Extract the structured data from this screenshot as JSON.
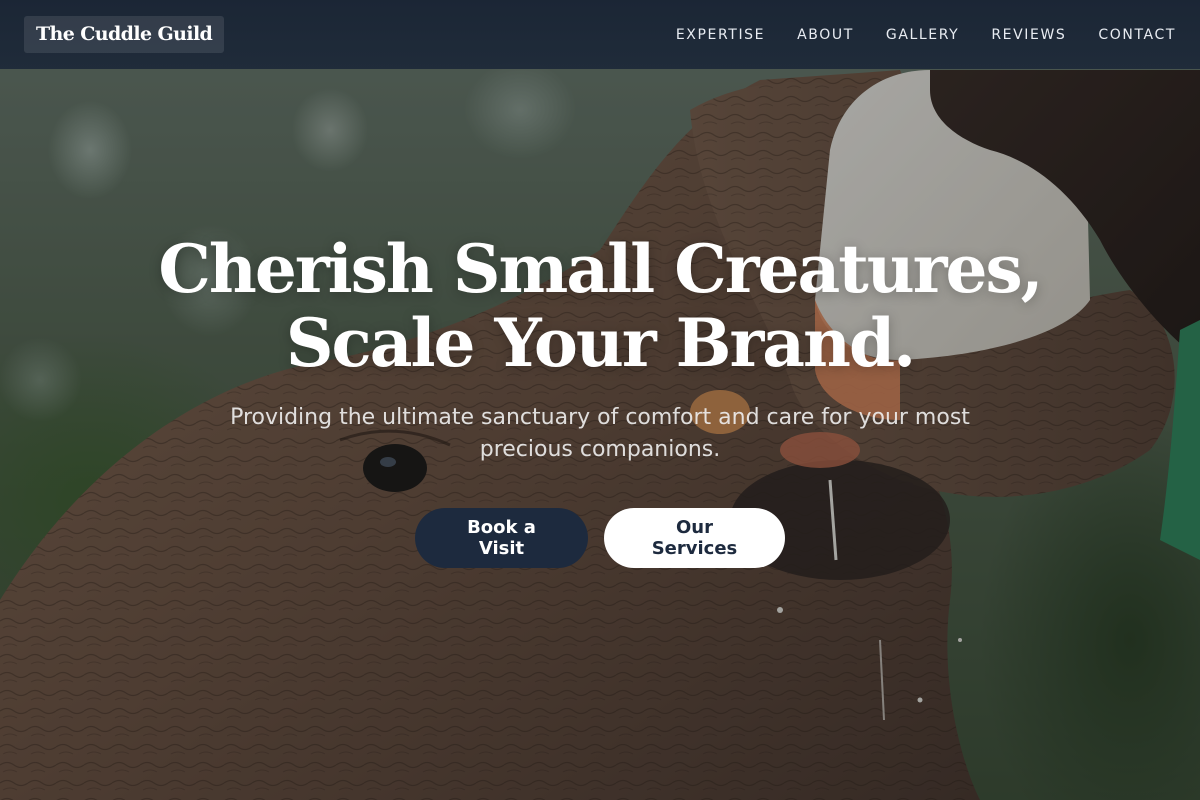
{
  "header": {
    "logo_text": "The Cuddle Guild",
    "nav": [
      {
        "label": "EXPERTISE"
      },
      {
        "label": "ABOUT"
      },
      {
        "label": "GALLERY"
      },
      {
        "label": "REVIEWS"
      },
      {
        "label": "CONTACT"
      }
    ]
  },
  "hero": {
    "headline_line1": "Cherish Small Creatures,",
    "headline_line2": "Scale Your Brand.",
    "subheadline": "Providing the ultimate sanctuary of comfort and care for your most precious companions.",
    "primary_button": "Book a Visit",
    "secondary_button": "Our Services",
    "image_subject": "baby elephant drinking from a milk bottle"
  },
  "colors": {
    "header_bg": "#1c2a3c",
    "primary_button_bg": "#1d2a3e",
    "secondary_button_bg": "#ffffff",
    "headline_text": "#ffffff"
  }
}
